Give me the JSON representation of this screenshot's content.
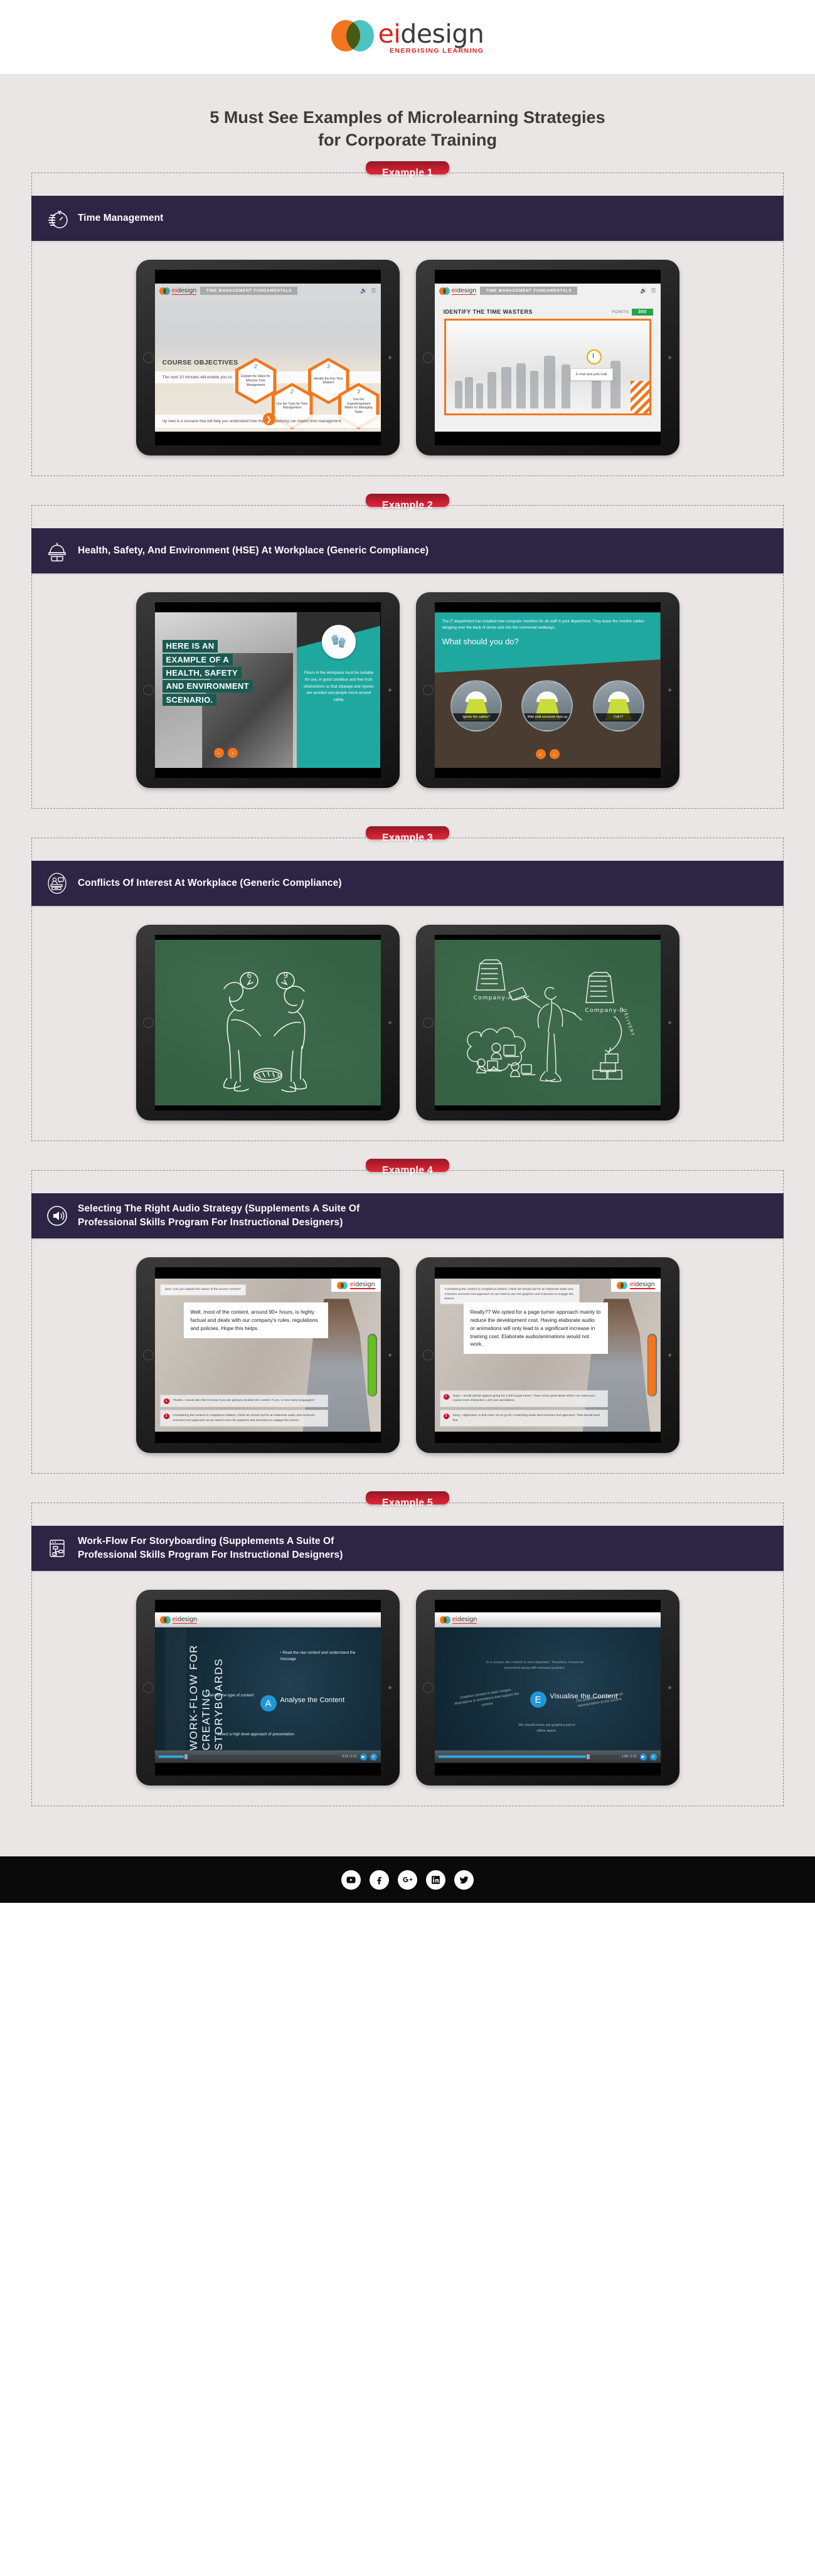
{
  "brand": {
    "name_ei": "ei",
    "name_design": "design",
    "tagline": "ENERGISING LEARNING",
    "colors": {
      "orange": "#f2761d",
      "teal": "#4cc3c0",
      "red": "#e02020",
      "header_purple": "#2c2544",
      "badge_red": "#e42437",
      "page_bg": "#e9e6e5"
    }
  },
  "headline": "5 Must See Examples of Microlearning Strategies for Corporate Training",
  "headline_line1": "5 Must See Examples of Microlearning Strategies",
  "headline_line2": "for Corporate Training",
  "examples": [
    {
      "badge": "Example 1",
      "icon": "stopwatch-icon",
      "title": "Time Management",
      "slides": [
        {
          "kind": "course-objectives",
          "course_chip": "TIME MANAGEMENT FUNDAMENTALS",
          "heading": "COURSE OBJECTIVES",
          "intro": "The next 10 minutes will enable you to:",
          "objectives": [
            {
              "num": "2",
              "label": "Explain the Steps for Effective Time Management"
            },
            {
              "num": "2",
              "label": "Use the Tools for Time Management"
            },
            {
              "num": "3",
              "label": "Identify the Key Time Wasters"
            },
            {
              "num": "3",
              "label": "Use the Urgent/Important Matrix for Managing Tasks"
            }
          ],
          "footer": "Up next is a scenario that will help you understand how improper planning can impact time management.",
          "next_icon": "chevron-right-icon"
        },
        {
          "kind": "time-wasters",
          "course_chip": "TIME MANAGEMENT FUNDAMENTALS",
          "heading": "IDENTIFY THE TIME WASTERS",
          "points_label": "POINTS",
          "points_value": "300",
          "tooltip": "E-mail and junk mail",
          "tooltip_icon": "clock-icon"
        }
      ]
    },
    {
      "badge": "Example 2",
      "icon": "hardhat-icon",
      "title": "Health, Safety, And Environment (HSE) At Workplace (Generic Compliance)",
      "slides": [
        {
          "kind": "hse-intro",
          "heading_lines": [
            "HERE IS AN",
            "EXAMPLE OF A",
            "HEALTH, SAFETY",
            "AND ENVIRONMENT",
            "SCENARIO."
          ],
          "badge_icon": "safety-gloves-icon",
          "body": "Floors in the workplace must be suitable for use, in good condition and free from obstructions so that slippage and injuries are avoided and people move around safely.",
          "nav": [
            "‹",
            "›"
          ]
        },
        {
          "kind": "hse-question",
          "intro": "The IT department has installed new computer monitors for all staff in your department. They leave the monitor cables dangling over the back of desks and into the communal walkways.",
          "question": "What should you do?",
          "options": [
            "Ignore the cables?",
            "Wait until someone trips up",
            "Call IT"
          ],
          "nav": [
            "‹",
            "›"
          ]
        }
      ]
    },
    {
      "badge": "Example 3",
      "icon": "desk-person-icon",
      "title": "Conflicts Of Interest At Workplace (Generic Compliance)",
      "slides": [
        {
          "kind": "chalk-six-nine",
          "bubble_left": "6",
          "bubble_right": "9",
          "note": "two men pointing at a coin on the ground, one sees 6 the other sees 9"
        },
        {
          "kind": "chalk-companies",
          "label_a": "Company-A",
          "label_b": "Company-B",
          "arrow_label": "DELIVERY",
          "note": "man passing money between Company-A and Company-B over a cloud of workers"
        }
      ]
    },
    {
      "badge": "Example 4",
      "icon": "speaker-icon",
      "title": "Selecting The Right Audio Strategy (Supplements A Suite Of Professional Skills Program For Instructional Designers)",
      "title_line1": "Selecting The Right Audio Strategy (Supplements A Suite Of",
      "title_line2": "Professional Skills Program For Instructional Designers)",
      "slides": [
        {
          "kind": "dialog",
          "top_bubble": "Sure. Can you explain the nature of the source content?",
          "main_bubble": "Well, most of the content, around 90+ hours, is highly factual and deals with our company's rules, regulations and policies. Hope this helps.",
          "choices": [
            {
              "num": "1",
              "text": "Thanks. I would also like to know if you are going to localise the content. If yes, in how many languages?"
            },
            {
              "num": "2",
              "text": "Considering the content is compliance-related, I think we should opt for an elaborate audio and minimum onscreen text approach as we need to use rich graphics and scenarios to engage the learner."
            }
          ],
          "meter_color": "green"
        },
        {
          "kind": "dialog",
          "top_bubble": "Considering the content is compliance-related, I think we should opt for an elaborate audio and minimum onscreen text approach as we need to use rich graphics and scenarios to engage the learner.",
          "main_bubble": "Really?? We opted for a page turner approach mainly to reduce the development cost. Having elaborate audio or animations will only lead to a significant increase in training cost. Elaborate audio/animations would not work.",
          "choices": [
            {
              "num": "1",
              "text": "Nope. I would advise against going for a strict page turner. I have some great ideas which can make your course more interactive. Let's use animations."
            },
            {
              "num": "2",
              "text": "Sorry, I digressed. In that case, let us go for a matching audio and onscreen text approach. That should work fine."
            }
          ],
          "meter_color": "orange"
        }
      ]
    },
    {
      "badge": "Example 5",
      "icon": "workflow-icon",
      "title": "Work-Flow For Storyboarding (Supplements A Suite Of Professional Skills Program For Instructional Designers)",
      "title_line1": "Work-Flow For Storyboarding (Supplements A Suite Of",
      "title_line2": "Professional Skills Program For Instructional Designers)",
      "slides": [
        {
          "kind": "video-analyse",
          "side_title": "WORK-FLOW FOR CREATING STORYBOARDS",
          "node_letter": "A",
          "node_label": "Analyse the Content",
          "bullets": [
            "Read the raw content and understand the message",
            "Identify the type of content",
            "Select a high level approach of presentation"
          ],
          "time": "0:11 / 1:12",
          "progress_percent": 14
        },
        {
          "kind": "video-visualise",
          "node_letter": "E",
          "node_label": "Visualise the Content",
          "cloud_texts": [
            "In a course, the content is very important. Therefore, it must be presented along with relevant graphics.",
            "Graphics consist of static images, illustrations or animations that support the content.",
            "The graphic should be a visual representative of the content.",
            "We should never put graphics just to utilize space."
          ],
          "time": "1:06 / 1:12",
          "progress_percent": 82
        }
      ]
    }
  ],
  "footer": {
    "social": [
      {
        "name": "youtube-icon",
        "glyph": "You"
      },
      {
        "name": "facebook-icon",
        "glyph": "f"
      },
      {
        "name": "googleplus-icon",
        "glyph": "g+"
      },
      {
        "name": "linkedin-icon",
        "glyph": "in"
      },
      {
        "name": "twitter-icon",
        "glyph": "t"
      }
    ]
  }
}
